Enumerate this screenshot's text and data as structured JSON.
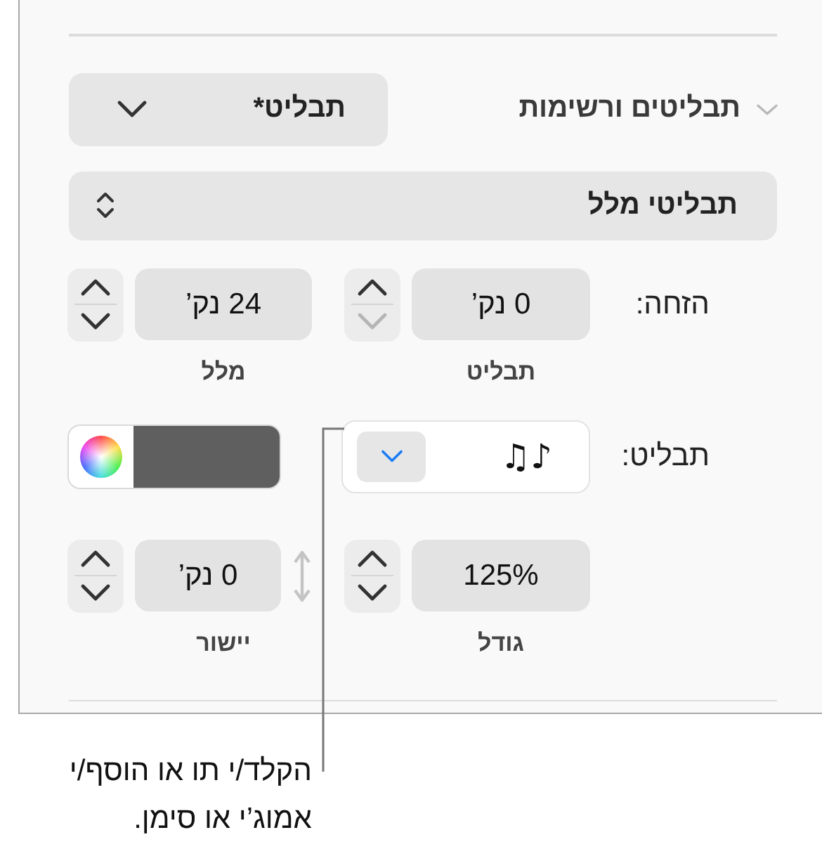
{
  "section": {
    "title": "תבליטים ורשימות",
    "expanded": true,
    "style_popup": "תבליט*"
  },
  "list_style": "תבליטי מלל",
  "indent": {
    "label": "הזחה:",
    "fields": [
      {
        "value": "0 נק’",
        "caption": "תבליט",
        "up_enabled": true,
        "down_enabled": false
      },
      {
        "value": "24 נק’",
        "caption": "מלל",
        "up_enabled": true,
        "down_enabled": true
      }
    ]
  },
  "bullet": {
    "label": "תבליט:",
    "value": "♫♪",
    "color": "#5f5f5f"
  },
  "size_row": {
    "fields": [
      {
        "value": "125%",
        "caption": "גודל",
        "up_enabled": true,
        "down_enabled": true
      },
      {
        "value": "0 נק’",
        "caption": "יישור",
        "up_enabled": true,
        "down_enabled": true
      }
    ]
  },
  "callout_lines": [
    "הקלד/י תו או הוסף/י",
    "אמוג’י או סימן."
  ]
}
